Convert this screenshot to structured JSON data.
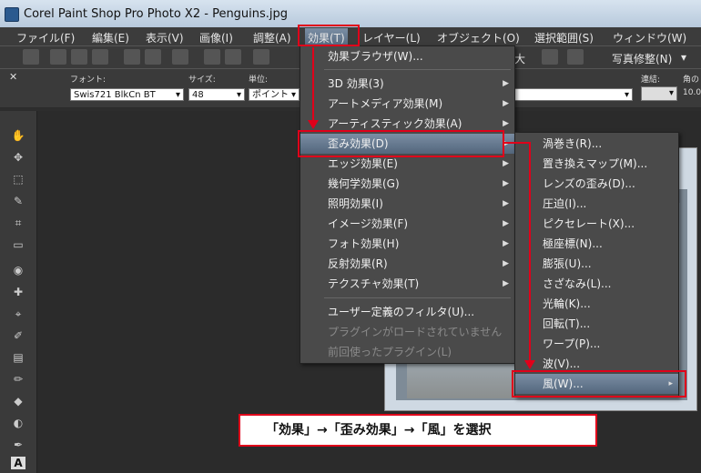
{
  "window": {
    "title": "Corel Paint Shop Pro Photo X2 - Penguins.jpg"
  },
  "menubar": [
    "ファイル(F)",
    "編集(E)",
    "表示(V)",
    "画像(I)",
    "調整(A)",
    "効果(T)",
    "レイヤー(L)",
    "オブジェクト(O)",
    "選択範囲(S)",
    "ウィンドウ(W)"
  ],
  "toolbar": {
    "photo_fix": "写真修整(N)",
    "photo_fix_arrow": "▾",
    "big": "大"
  },
  "options": {
    "font_label": "フォント:",
    "font_value": "Swis721 BlkCn BT",
    "size_label": "サイズ:",
    "size_value": "48",
    "unit_label": "単位:",
    "unit_value": "ポイント",
    "connect_label": "連結:",
    "angle_label": "角の",
    "angle_value": "10.0"
  },
  "effects_menu": [
    {
      "label": "効果ブラウザ(W)...",
      "arrow": ""
    },
    {
      "label": "3D 効果(3)",
      "arrow": "▶"
    },
    {
      "label": "アートメディア効果(M)",
      "arrow": "▶"
    },
    {
      "label": "アーティスティック効果(A)",
      "arrow": "▶"
    },
    {
      "label": "歪み効果(D)",
      "arrow": "▶",
      "highlight": true
    },
    {
      "label": "エッジ効果(E)",
      "arrow": "▶"
    },
    {
      "label": "幾何学効果(G)",
      "arrow": "▶"
    },
    {
      "label": "照明効果(I)",
      "arrow": "▶"
    },
    {
      "label": "イメージ効果(F)",
      "arrow": "▶"
    },
    {
      "label": "フォト効果(H)",
      "arrow": "▶"
    },
    {
      "label": "反射効果(R)",
      "arrow": "▶"
    },
    {
      "label": "テクスチャ効果(T)",
      "arrow": "▶"
    },
    {
      "label": "ユーザー定義のフィルタ(U)...",
      "arrow": ""
    },
    {
      "label": "プラグインがロードされていません",
      "arrow": "",
      "disabled": true
    },
    {
      "label": "前回使ったプラグイン(L)",
      "arrow": "",
      "disabled": true
    }
  ],
  "distort_menu": [
    "渦巻き(R)...",
    "置き換えマップ(M)...",
    "レンズの歪み(D)...",
    "圧迫(I)...",
    "ピクセレート(X)...",
    "極座標(N)...",
    "膨張(U)...",
    "さざなみ(L)...",
    "光輪(K)...",
    "回転(T)...",
    "ワープ(P)...",
    "波(V)...",
    "風(W)..."
  ],
  "callout": "「効果」→「歪み効果」→「風」を選択",
  "colors": {
    "accent_red": "#e0001a",
    "menu_bg": "#4a4a4a",
    "highlight": "#6a7d93"
  }
}
